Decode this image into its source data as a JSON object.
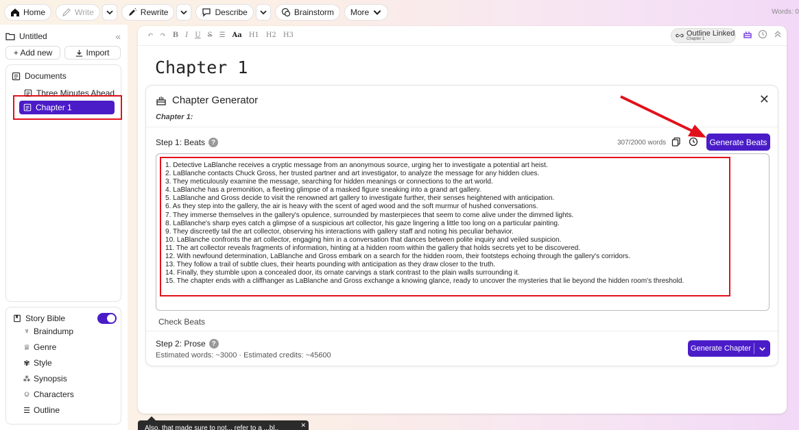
{
  "toolbar": {
    "home": "Home",
    "write": "Write",
    "rewrite": "Rewrite",
    "describe": "Describe",
    "brainstorm": "Brainstorm",
    "more": "More",
    "words": "Words: 0"
  },
  "sidebar": {
    "doc_title": "Untitled",
    "add_new": "+ Add new",
    "import": "Import",
    "documents_label": "Documents",
    "documents": [
      "Three Minutes Ahead...",
      "Chapter 1"
    ],
    "story_bible_label": "Story Bible",
    "story_bible_items": [
      "Braindump",
      "Genre",
      "Style",
      "Synopsis",
      "Characters",
      "Outline"
    ]
  },
  "editor": {
    "outline_linked": "Outline Linked",
    "outline_chapter": "Chapter 1",
    "chapter_title": "Chapter 1"
  },
  "generator": {
    "title": "Chapter Generator",
    "subtitle": "Chapter 1:",
    "step1_label": "Step 1: Beats",
    "word_count": "307/2000 words",
    "generate_beats": "Generate Beats",
    "beats": [
      "1. Detective LaBlanche receives a cryptic message from an anonymous source, urging her to investigate a potential art heist.",
      "2. LaBlanche contacts Chuck Gross, her trusted partner and art investigator, to analyze the message for any hidden clues.",
      "3. They meticulously examine the message, searching for hidden meanings or connections to the art world.",
      "4. LaBlanche has a premonition, a fleeting glimpse of a masked figure sneaking into a grand art gallery.",
      "5. LaBlanche and Gross decide to visit the renowned art gallery to investigate further, their senses heightened with anticipation.",
      "6. As they step into the gallery, the air is heavy with the scent of aged wood and the soft murmur of hushed conversations.",
      "7. They immerse themselves in the gallery's opulence, surrounded by masterpieces that seem to come alive under the dimmed lights.",
      "8. LaBlanche's sharp eyes catch a glimpse of a suspicious art collector, his gaze lingering a little too long on a particular painting.",
      "9. They discreetly tail the art collector, observing his interactions with gallery staff and noting his peculiar behavior.",
      "10. LaBlanche confronts the art collector, engaging him in a conversation that dances between polite inquiry and veiled suspicion.",
      "11. The art collector reveals fragments of information, hinting at a hidden room within the gallery that holds secrets yet to be discovered.",
      "12. With newfound determination, LaBlanche and Gross embark on a search for the hidden room, their footsteps echoing through the gallery's corridors.",
      "13. They follow a trail of subtle clues, their hearts pounding with anticipation as they draw closer to the truth.",
      "14. Finally, they stumble upon a concealed door, its ornate carvings a stark contrast to the plain walls surrounding it.",
      "15. The chapter ends with a cliffhanger as LaBlanche and Gross exchange a knowing glance, ready to uncover the mysteries that lie beyond the hidden room's threshold."
    ],
    "check_beats": "Check Beats",
    "step2_label": "Step 2: Prose",
    "estimate": "Estimated words: ~3000 · Estimated credits: ~45600",
    "generate_chapter": "Generate Chapter"
  },
  "tooltip": {
    "text": "Also, that made sure to not... refer to a ...bl.."
  },
  "colors": {
    "accent": "#4a1cc8",
    "annotation": "#e2101b"
  }
}
